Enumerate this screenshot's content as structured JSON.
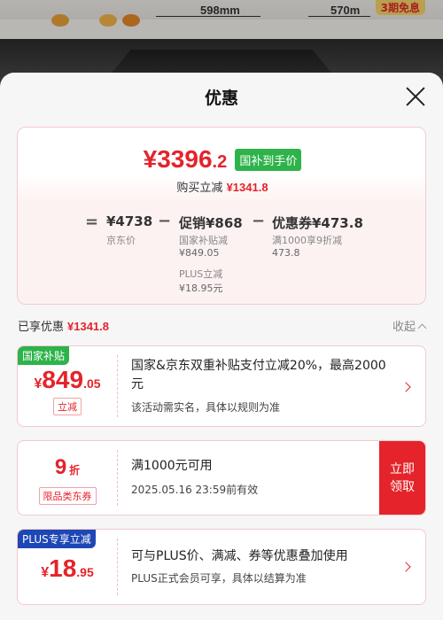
{
  "background": {
    "dim_left": "598mm",
    "dim_right": "570m",
    "promo_tag": "3期免息"
  },
  "sheet": {
    "title": "优惠"
  },
  "summary": {
    "final_price_int": "¥3396",
    "final_price_dec": ".2",
    "badge": "国补到手价",
    "save_label": "购买立减",
    "save_amount": "¥1341.8",
    "equals": "=",
    "minus1": "−",
    "minus2": "−",
    "jd_price": "¥4738",
    "jd_price_label": "京东价",
    "promo_price": "促销¥868",
    "promo_sub1_label": "国家补贴减",
    "promo_sub1_value": "¥849.05",
    "promo_sub2_label": "PLUS立减",
    "promo_sub2_value": "¥18.95元",
    "coupon_price": "优惠券¥473.8",
    "coupon_sub_label": "满1000享9折减",
    "coupon_sub_value": "473.8"
  },
  "applied": {
    "label": "已享优惠",
    "amount": "¥1341.8",
    "collapse_label": "收起"
  },
  "coupons": [
    {
      "tag": "国家补贴",
      "yen": "¥",
      "int": "849",
      "dec": ".05",
      "chip": "立减",
      "text": "国家&京东双重补贴支付立减20%，最高2000元",
      "note": "该活动需实名，具体以规则为准"
    },
    {
      "int": "9",
      "unit": "折",
      "chip": "限品类东券",
      "text": "满1000元可用",
      "note": "2025.05.16 23:59前有效",
      "claim": "立即领取"
    },
    {
      "tag": "PLUS专享立减",
      "yen": "¥",
      "int": "18",
      "dec": ".95",
      "text": "可与PLUS价、满减、券等优惠叠加使用",
      "note": "PLUS正式会员可享，具体以结算为准"
    }
  ],
  "colors": {
    "accent_red": "#e4232b",
    "subsidy_green": "#2db34a",
    "plus_blue": "#1d47b6"
  }
}
